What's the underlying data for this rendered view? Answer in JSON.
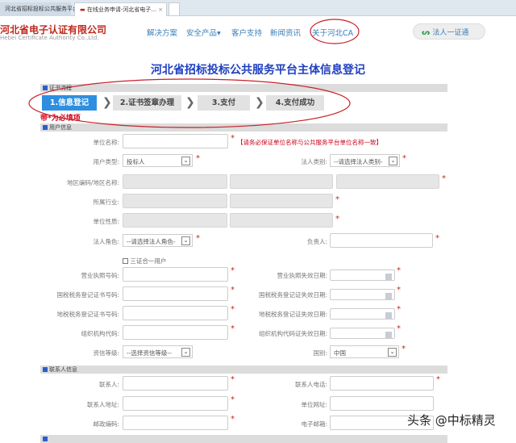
{
  "browser": {
    "tabs": [
      "河北省招标投标公共服务平台",
      "在线业务申请-河北省电子..."
    ],
    "close": "×"
  },
  "header": {
    "company": "河北省电子认证有限公司",
    "company_en": "Hebei Certificate Authority Co.,Ltd.",
    "nav": [
      "解决方案",
      "安全产品▾",
      "客户支持",
      "新闻资讯",
      "关于河北CA"
    ],
    "login": "法人一证通"
  },
  "page": {
    "title": "河北省招标投标公共服务平台主体信息登记"
  },
  "process": {
    "section": "证书流程",
    "steps": [
      "1.信息登记",
      "2.证书签章办理",
      "3.支付",
      "4.支付成功"
    ],
    "active_step": 1,
    "arrow": "❯",
    "required_note": "带*为必填项"
  },
  "user_info": {
    "section": "用户信息",
    "unit_name": {
      "label": "单位名称:",
      "note": "【请务必保证单位名称与公共服务平台单位名称一致】"
    },
    "user_type": {
      "label": "用户类型:",
      "value": "投标人"
    },
    "legal_category": {
      "label": "法人类别:",
      "value": "--请选择法人类别-"
    },
    "region": {
      "label": "地区编码/地区名称:"
    },
    "industry": {
      "label": "所属行业:"
    },
    "unit_nature": {
      "label": "单位性质:"
    },
    "legal_role": {
      "label": "法人角色:",
      "value": "--请选择法人角色-"
    },
    "principal": {
      "label": "负责人:"
    },
    "three_in_one": {
      "label": "三证合一用户",
      "checked": false
    },
    "license_no": {
      "label": "营业执照号码:"
    },
    "license_exp": {
      "label": "营业执照失效日期:"
    },
    "national_tax_no": {
      "label": "国税税务登记证书号码:"
    },
    "national_tax_exp": {
      "label": "国税税务登记证失效日期:"
    },
    "local_tax_no": {
      "label": "地税税务登记证书号码:"
    },
    "local_tax_exp": {
      "label": "地税税务登记证失效日期:"
    },
    "org_code": {
      "label": "组织机构代码:"
    },
    "org_code_exp": {
      "label": "组织机构代码证失效日期:"
    },
    "credit_level": {
      "label": "资信等级:",
      "value": "--选择资信等级--"
    },
    "country": {
      "label": "国别:",
      "value": "中国"
    }
  },
  "contact_info": {
    "section": "联系人信息",
    "contact": {
      "label": "联系人:"
    },
    "phone": {
      "label": "联系人电话:"
    },
    "address": {
      "label": "联系人地址:"
    },
    "website": {
      "label": "单位网址:"
    },
    "postcode": {
      "label": "邮政编码:"
    },
    "email": {
      "label": "电子邮箱:"
    }
  },
  "required_mark": "*",
  "watermark": "头条 @中标精灵"
}
